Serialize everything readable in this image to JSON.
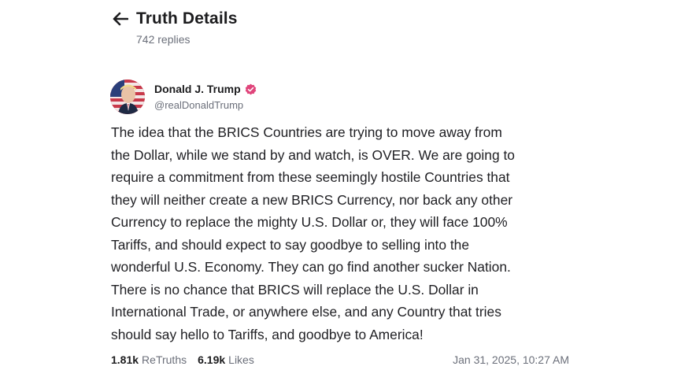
{
  "header": {
    "title": "Truth Details",
    "replies": "742 replies",
    "back_icon": "arrow-left-icon"
  },
  "post": {
    "author": {
      "name": "Donald J. Trump",
      "handle": "@realDonaldTrump",
      "verified_icon": "verified-badge-icon",
      "badge_color": "#e0457b"
    },
    "lines": [
      "The idea that the BRICS Countries are trying to move away from",
      "the Dollar, while we stand by and watch, is OVER. We are going to",
      "require a commitment from these seemingly hostile Countries that",
      "they will neither create a new BRICS Currency, nor back any other",
      "Currency to replace the mighty U.S. Dollar or, they will face 100%",
      "Tariffs, and should expect to say goodbye to selling into the",
      "wonderful U.S. Economy. They can go find another sucker Nation.",
      "There is no chance that BRICS will replace the U.S. Dollar in",
      "International Trade, or anywhere else, and any Country that tries",
      "should say hello to Tariffs, and goodbye to America!"
    ],
    "stats": {
      "retruths_count": "1.81k",
      "retruths_label": "ReTruths",
      "likes_count": "6.19k",
      "likes_label": "Likes"
    },
    "timestamp": "Jan 31, 2025, 10:27 AM"
  }
}
